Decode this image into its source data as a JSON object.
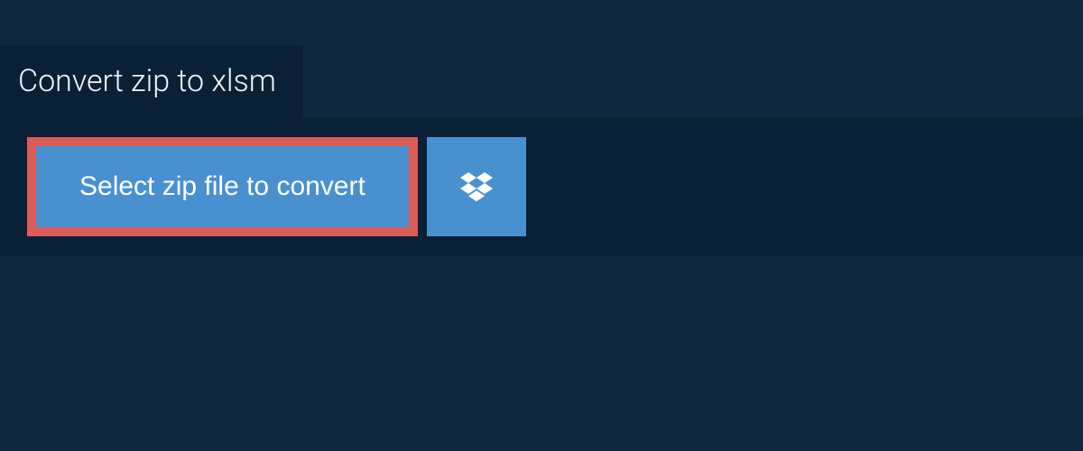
{
  "header": {
    "title": "Convert zip to xlsm"
  },
  "upload": {
    "select_label": "Select zip file to convert"
  },
  "colors": {
    "page_bg": "#11293e",
    "panel_bg": "#0a2036",
    "button_bg": "#4990d0",
    "button_border_highlight": "#d95c57",
    "text": "#ffffff"
  }
}
